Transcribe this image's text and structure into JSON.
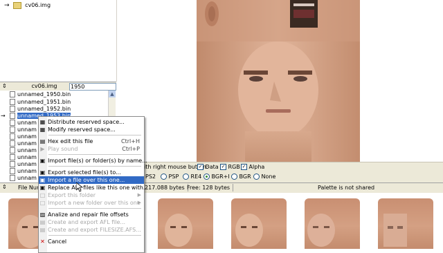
{
  "tree": {
    "items": [
      {
        "label": "cv06.img",
        "icon": "arrow-icon"
      }
    ]
  },
  "pathbar": {
    "value": "cv06.img",
    "search": "1950"
  },
  "files": {
    "rows": [
      {
        "label": "unnamed_1950.bin"
      },
      {
        "label": "unnamed_1951.bin"
      },
      {
        "label": "unnamed_1952.bin"
      },
      {
        "label": "unnamed_1953.bin",
        "selected": true
      },
      {
        "label": "unnam"
      },
      {
        "label": "unnam"
      },
      {
        "label": "unnam"
      },
      {
        "label": "unnam"
      },
      {
        "label": "unnam"
      },
      {
        "label": "unnam"
      },
      {
        "label": "unnam"
      },
      {
        "label": "unnam"
      },
      {
        "label": "unnam"
      }
    ]
  },
  "options": {
    "mouse_label": "ith right mouse button:",
    "checks": [
      {
        "label": "Data",
        "checked": true
      },
      {
        "label": "RGB",
        "checked": true
      },
      {
        "label": "Alpha",
        "checked": true
      }
    ],
    "radios": [
      {
        "label": "PS2",
        "on": false
      },
      {
        "label": "PSP",
        "on": false
      },
      {
        "label": "RE4",
        "on": false
      },
      {
        "label": "BGR+I",
        "on": true
      },
      {
        "label": "BGR",
        "on": false
      },
      {
        "label": "None",
        "on": false
      }
    ]
  },
  "status": {
    "file_num": "File Num",
    "bytes": "217.088 bytes",
    "free": "Free: 128 bytes",
    "palette": "Palette is not shared"
  },
  "menu": {
    "items": [
      {
        "label": "Distribute reserved space...",
        "icon": "grid-icon",
        "disabled": false
      },
      {
        "label": "Modify reserved space...",
        "icon": "grid-icon",
        "disabled": false
      },
      {
        "label": "Hex edit this file",
        "icon": "hex-icon",
        "shortcut": "Ctrl+H",
        "disabled": false
      },
      {
        "label": "Play sound",
        "icon": "speaker-icon",
        "shortcut": "Ctrl+P",
        "disabled": true
      },
      {
        "label": "Import file(s) or folder(s) by name...",
        "icon": "import-icon",
        "disabled": false
      },
      {
        "label": "Export selected file(s) to...",
        "icon": "export-icon",
        "disabled": false
      },
      {
        "label": "Import a file over this one...",
        "icon": "import-over-icon",
        "disabled": false,
        "highlighted": true
      },
      {
        "label": "Replace ALL files like this one with...",
        "icon": "replace-icon",
        "disabled": false
      },
      {
        "label": "Export this folder",
        "icon": "folder-icon",
        "disabled": true,
        "submenu": true
      },
      {
        "label": "Import a new folder over this one",
        "icon": "folder-icon",
        "disabled": true,
        "submenu": true
      },
      {
        "label": "Analize and repair file offsets",
        "icon": "repair-icon",
        "disabled": false
      },
      {
        "label": "Create and export AFL file...",
        "icon": "afl-icon",
        "disabled": true
      },
      {
        "label": "Create and export FILESIZE.AFS...",
        "icon": "afs-icon",
        "disabled": true
      },
      {
        "label": "Cancel",
        "icon": "cancel-icon",
        "disabled": false
      }
    ]
  },
  "colors": {
    "highlight": "#316ac5",
    "panel": "#ece9d8",
    "skin": "#d4a083"
  }
}
